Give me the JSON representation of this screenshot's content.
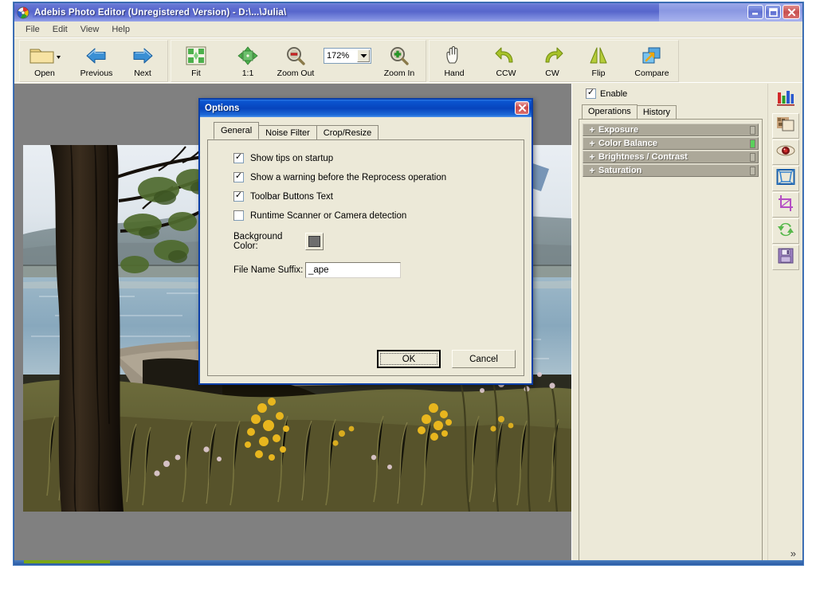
{
  "app": {
    "title": "Adebis Photo Editor (Unregistered Version) - D:\\...\\Julia\\",
    "icon": "app-palette-icon",
    "window_buttons": {
      "minimize": "_",
      "maximize": "□",
      "close": "×"
    }
  },
  "menubar": {
    "items": [
      "File",
      "Edit",
      "View",
      "Help"
    ]
  },
  "toolbar": {
    "items": [
      {
        "label": "Open",
        "icon": "folder-icon",
        "has_dropdown": true
      },
      {
        "label": "Previous",
        "icon": "arrow-left-icon"
      },
      {
        "label": "Next",
        "icon": "arrow-right-icon"
      },
      {
        "label": "Fit",
        "icon": "fit-icon"
      },
      {
        "label": "1:1",
        "icon": "actual-size-icon"
      },
      {
        "label": "Zoom Out",
        "icon": "magnifier-minus-icon"
      },
      {
        "label": "Zoom In",
        "icon": "magnifier-plus-icon"
      },
      {
        "label": "Hand",
        "icon": "hand-icon"
      },
      {
        "label": "CCW",
        "icon": "rotate-ccw-icon"
      },
      {
        "label": "CW",
        "icon": "rotate-cw-icon"
      },
      {
        "label": "Flip",
        "icon": "flip-icon"
      },
      {
        "label": "Compare",
        "icon": "compare-icon"
      }
    ],
    "zoom": {
      "value": "172%",
      "dropdown_icon": "chevron-down-icon"
    }
  },
  "dock": {
    "enable": {
      "label": "Enable",
      "checked": true
    },
    "tabs": [
      {
        "label": "Operations",
        "active": true
      },
      {
        "label": "History",
        "active": false
      }
    ],
    "operations": [
      {
        "expander": "+",
        "label": "Exposure",
        "indicator": "gray"
      },
      {
        "expander": "+",
        "label": "Color Balance",
        "indicator": "green"
      },
      {
        "expander": "+",
        "label": "Brightness / Contrast",
        "indicator": "gray"
      },
      {
        "expander": "+",
        "label": "Saturation",
        "indicator": "gray"
      }
    ],
    "strip_buttons": [
      {
        "icon": "histogram-icon",
        "framed": false
      },
      {
        "icon": "image-texture-icon",
        "framed": true
      },
      {
        "icon": "red-eye-icon",
        "framed": true
      },
      {
        "icon": "frame-border-icon",
        "framed": true
      },
      {
        "icon": "crop-icon",
        "framed": true
      },
      {
        "icon": "rotate-refresh-icon",
        "framed": true
      },
      {
        "icon": "save-floppy-icon",
        "framed": true
      }
    ],
    "expand_more": "»"
  },
  "dialog": {
    "title": "Options",
    "close_icon": "close-icon",
    "tabs": [
      {
        "label": "General",
        "active": true
      },
      {
        "label": "Noise Filter",
        "active": false
      },
      {
        "label": "Crop/Resize",
        "active": false
      }
    ],
    "checkboxes": [
      {
        "label": "Show tips on startup",
        "checked": true
      },
      {
        "label": "Show a warning before the Reprocess operation",
        "checked": true
      },
      {
        "label": "Toolbar Buttons Text",
        "checked": true
      },
      {
        "label": "Runtime Scanner or Camera detection",
        "checked": false
      }
    ],
    "background_color": {
      "label": "Background Color:",
      "value": "#6e6e6e"
    },
    "file_name_suffix": {
      "label": "File Name Suffix:",
      "value": "_ape",
      "placeholder": ""
    },
    "buttons": {
      "ok": "OK",
      "cancel": "Cancel"
    }
  },
  "colors": {
    "title_blue": "#5766cc",
    "dialog_blue": "#0744bd",
    "face": "#ece9d8",
    "canvas_gray": "#808080",
    "op_row": "#aca899",
    "accent_green": "#5bd05b"
  }
}
